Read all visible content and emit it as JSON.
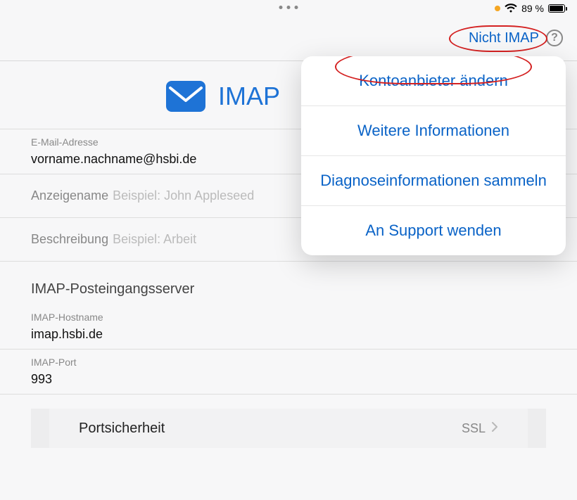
{
  "status": {
    "battery_text": "89 %"
  },
  "nav": {
    "not_imap": "Nicht IMAP",
    "help": "?"
  },
  "title": "IMAP",
  "fields": {
    "email_label": "E-Mail-Adresse",
    "email_value": "vorname.nachname@hsbi.de",
    "displayname_label": "Anzeigename",
    "displayname_placeholder": "Beispiel: John Appleseed",
    "description_label": "Beschreibung",
    "description_placeholder": "Beispiel: Arbeit"
  },
  "section": {
    "incoming_title": "IMAP-Posteingangsserver",
    "host_label": "IMAP-Hostname",
    "host_value": "imap.hsbi.de",
    "port_label": "IMAP-Port",
    "port_value": "993",
    "port_security_label": "Portsicherheit",
    "port_security_value": "SSL"
  },
  "popover": {
    "items": [
      "Kontoanbieter ändern",
      "Weitere Informationen",
      "Diagnoseinformationen sammeln",
      "An Support wenden"
    ]
  }
}
